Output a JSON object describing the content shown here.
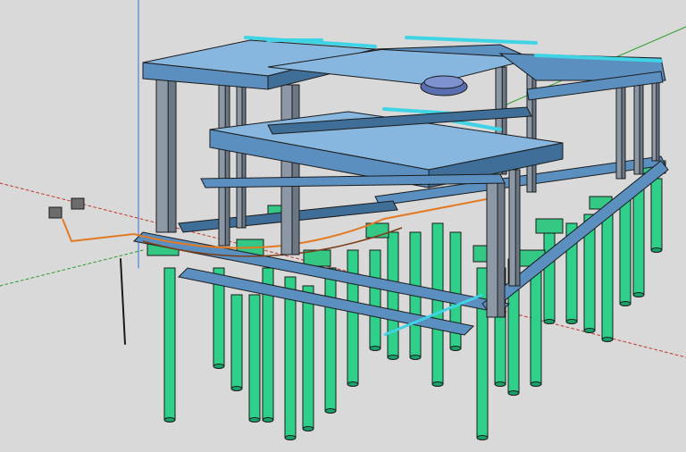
{
  "viewport": {
    "background": "#d9d9d9",
    "axes": {
      "red": "#c0392b",
      "green": "#2e9e2e",
      "blue": "#2f6fd6"
    },
    "colors": {
      "beam": "#5b8fbf",
      "beam_dark": "#3f6f99",
      "slab": "#87b6de",
      "column": "#8c98a6",
      "column_dark": "#6b7784",
      "pile": "#2fd08a",
      "pile_dark": "#1aa06a",
      "pipe_cyan": "#3fd3e6",
      "pipe_orange": "#e27a24",
      "green_block": "#35c784",
      "dark_line": "#1b1b1b"
    }
  }
}
